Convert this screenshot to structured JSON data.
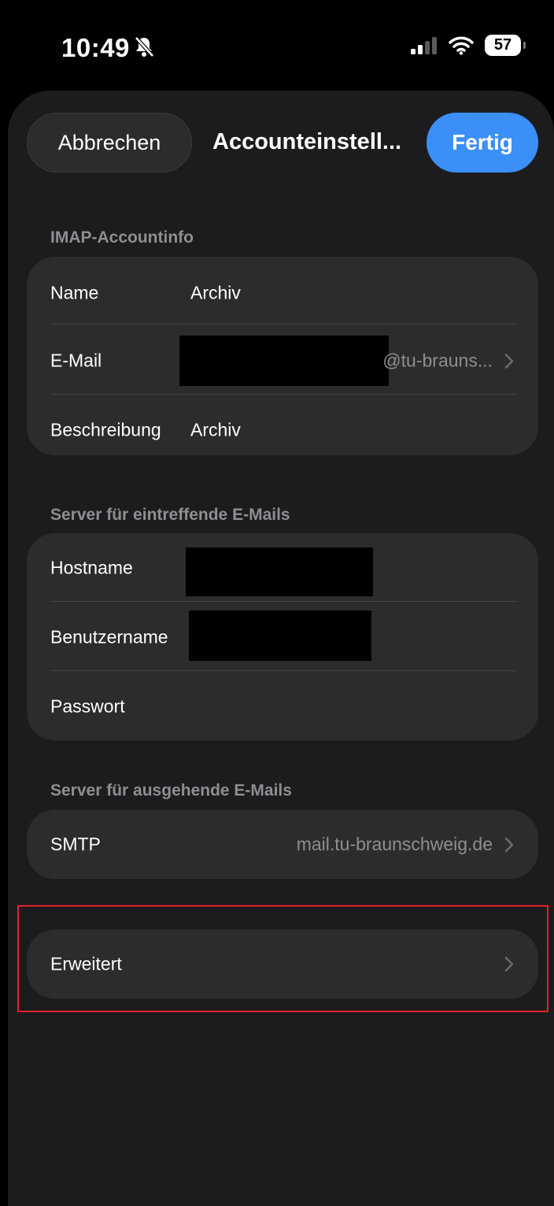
{
  "status_bar": {
    "time": "10:49",
    "battery": "57"
  },
  "nav": {
    "cancel_label": "Abbrechen",
    "title": "Accounteinstell...",
    "done_label": "Fertig"
  },
  "imap": {
    "header": "IMAP-Accountinfo",
    "name_label": "Name",
    "name_value": "Archiv",
    "email_label": "E-Mail",
    "email_suffix": "@tu-brauns...",
    "description_label": "Beschreibung",
    "description_value": "Archiv"
  },
  "incoming": {
    "header": "Server für eintreffende E-Mails",
    "hostname_label": "Hostname",
    "username_label": "Benutzername",
    "password_label": "Passwort"
  },
  "outgoing": {
    "header": "Server für ausgehende E-Mails",
    "smtp_label": "SMTP",
    "smtp_value": "mail.tu-braunschweig.de"
  },
  "advanced": {
    "label": "Erweitert"
  },
  "colors": {
    "accent": "#3b8ff6",
    "highlight": "#e0222a"
  }
}
